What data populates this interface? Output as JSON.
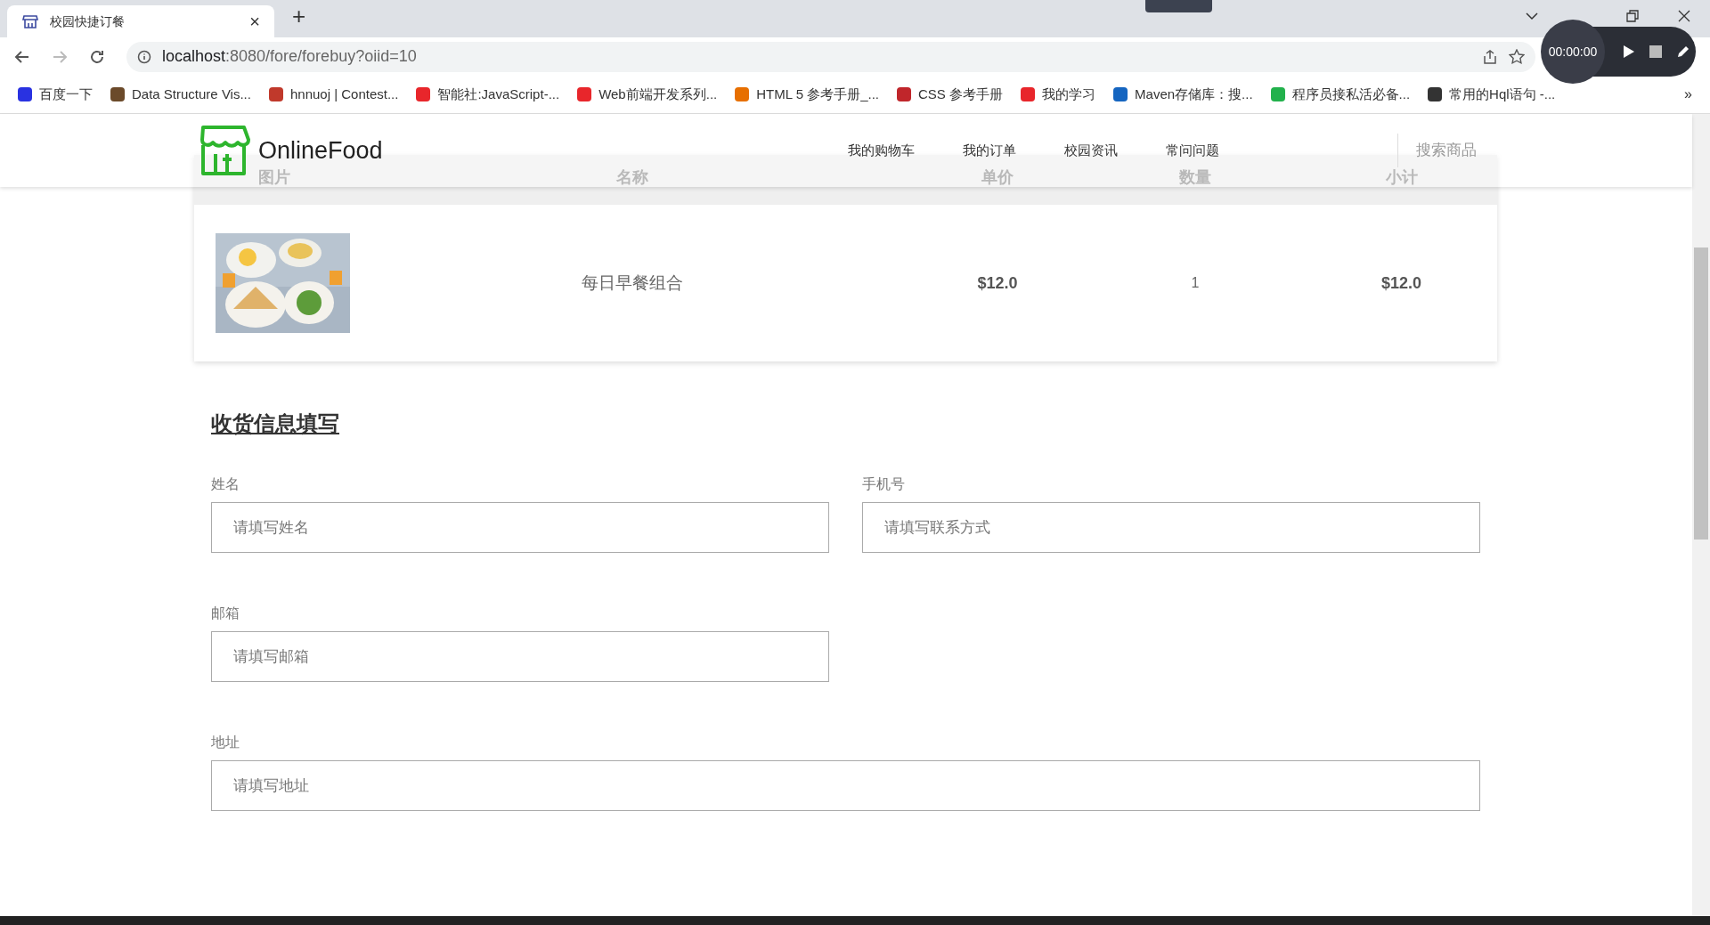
{
  "browser": {
    "tab": {
      "title": "校园快捷订餐",
      "close": "×"
    },
    "new_tab": "+",
    "url_host": "localhost",
    "url_rest": ":8080/fore/forebuy?oiid=10",
    "bookmarks": [
      {
        "label": "百度一下"
      },
      {
        "label": "Data Structure Vis..."
      },
      {
        "label": "hnnuoj | Contest..."
      },
      {
        "label": "智能社:JavaScript-..."
      },
      {
        "label": "Web前端开发系列..."
      },
      {
        "label": "HTML 5 参考手册_..."
      },
      {
        "label": "CSS 参考手册"
      },
      {
        "label": "我的学习"
      },
      {
        "label": "Maven存储库：搜..."
      },
      {
        "label": "程序员接私活必备..."
      },
      {
        "label": "常用的Hql语句 -..."
      }
    ],
    "more": "»"
  },
  "recorder": {
    "time": "00:00:00"
  },
  "site": {
    "logo": "OnlineFood",
    "nav": [
      "我的购物车",
      "我的订单",
      "校园资讯",
      "常问问题"
    ],
    "search": "搜索商品"
  },
  "table": {
    "columns": [
      "图片",
      "名称",
      "单价",
      "数量",
      "小计"
    ],
    "rows": [
      {
        "name": "每日早餐组合",
        "price": "$12.0",
        "quantity": "1",
        "subtotal": "$12.0"
      }
    ]
  },
  "form": {
    "title": "收货信息填写",
    "fields": [
      {
        "label": "姓名",
        "placeholder": "请填写姓名"
      },
      {
        "label": "手机号",
        "placeholder": "请填写联系方式"
      },
      {
        "label": "邮箱",
        "placeholder": "请填写邮箱"
      },
      {
        "label": "地址",
        "placeholder": "请填写地址"
      }
    ]
  }
}
